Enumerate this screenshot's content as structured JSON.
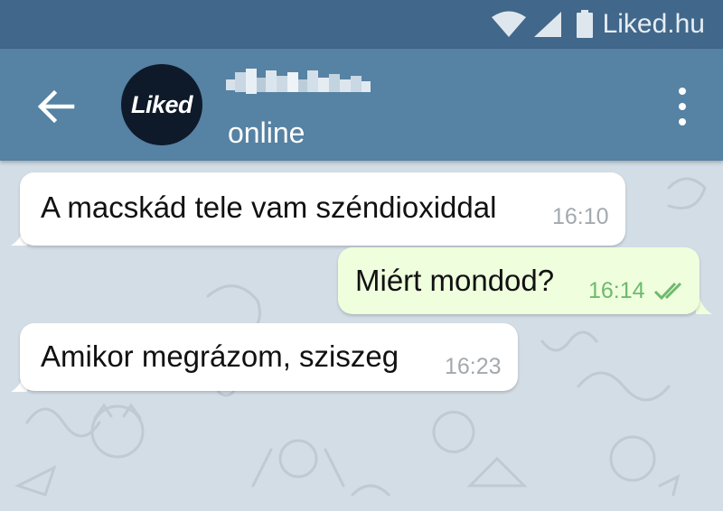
{
  "status_bar": {
    "carrier": "Liked.hu",
    "icons": [
      "wifi-icon",
      "signal-icon",
      "battery-icon"
    ]
  },
  "header": {
    "back_icon": "arrow-left-icon",
    "avatar_text": "Liked",
    "contact_status": "online",
    "menu_icon": "more-vertical-icon"
  },
  "messages": [
    {
      "direction": "incoming",
      "text": "A macskád tele vam széndioxiddal",
      "time": "16:10"
    },
    {
      "direction": "outgoing",
      "text": "Miért mondod?",
      "time": "16:14",
      "status_icon": "double-check-icon"
    },
    {
      "direction": "incoming",
      "text": "Amikor megrázom, sziszeg",
      "time": "16:23"
    }
  ],
  "colors": {
    "status_bar": "#41678a",
    "header": "#5682a3",
    "chat_background": "#d3dde6",
    "incoming_bubble": "#ffffff",
    "outgoing_bubble": "#effedd",
    "outgoing_time": "#6eb96e"
  }
}
